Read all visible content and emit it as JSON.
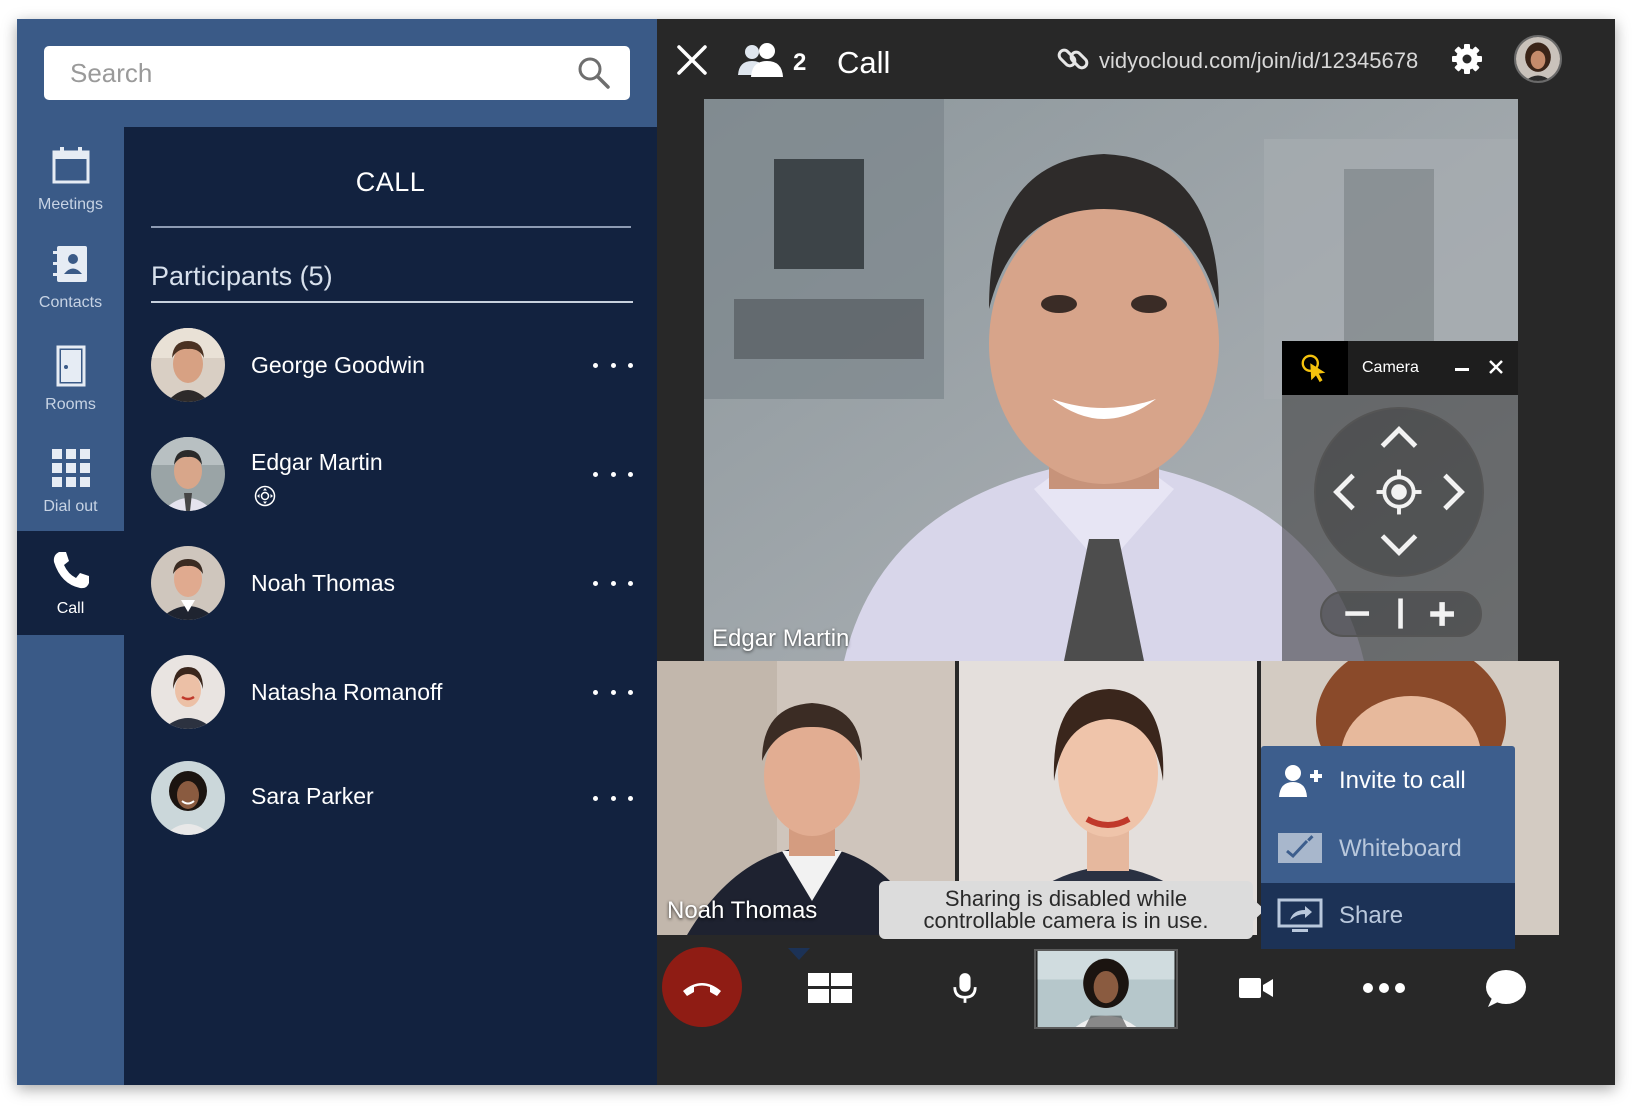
{
  "search": {
    "placeholder": "Search"
  },
  "nav": {
    "items": [
      {
        "label": "Meetings",
        "icon": "calendar-icon"
      },
      {
        "label": "Contacts",
        "icon": "contacts-icon"
      },
      {
        "label": "Rooms",
        "icon": "door-icon"
      },
      {
        "label": "Dial out",
        "icon": "dialpad-icon"
      },
      {
        "label": "Call",
        "icon": "phone-icon",
        "active": true
      }
    ]
  },
  "call_panel": {
    "title": "CALL",
    "participants_heading": "Participants (5)",
    "participants": [
      {
        "name": "George Goodwin"
      },
      {
        "name": "Edgar Martin",
        "has_camera_control": true
      },
      {
        "name": "Noah Thomas"
      },
      {
        "name": "Natasha Romanoff"
      },
      {
        "name": "Sara Parker"
      }
    ]
  },
  "top_bar": {
    "participant_count": "2",
    "call_label": "Call",
    "call_link": "vidyocloud.com/join/id/12345678"
  },
  "main_video": {
    "name": "Edgar Martin"
  },
  "camera_control": {
    "title": "Camera"
  },
  "thumbnails": [
    {
      "name": "Noah Thomas"
    },
    {
      "name": ""
    },
    {
      "name": ""
    }
  ],
  "tooltip": {
    "line1": "Sharing is disabled while",
    "line2": "controllable camera is in use."
  },
  "more_menu": {
    "invite": "Invite to call",
    "whiteboard": "Whiteboard",
    "share": "Share"
  },
  "colors": {
    "sidebar": "#3a5a87",
    "panel": "#12223f",
    "hangup": "#8f1c14",
    "menu": "#3d5e8d",
    "pointer_accent": "#f4c20d"
  }
}
